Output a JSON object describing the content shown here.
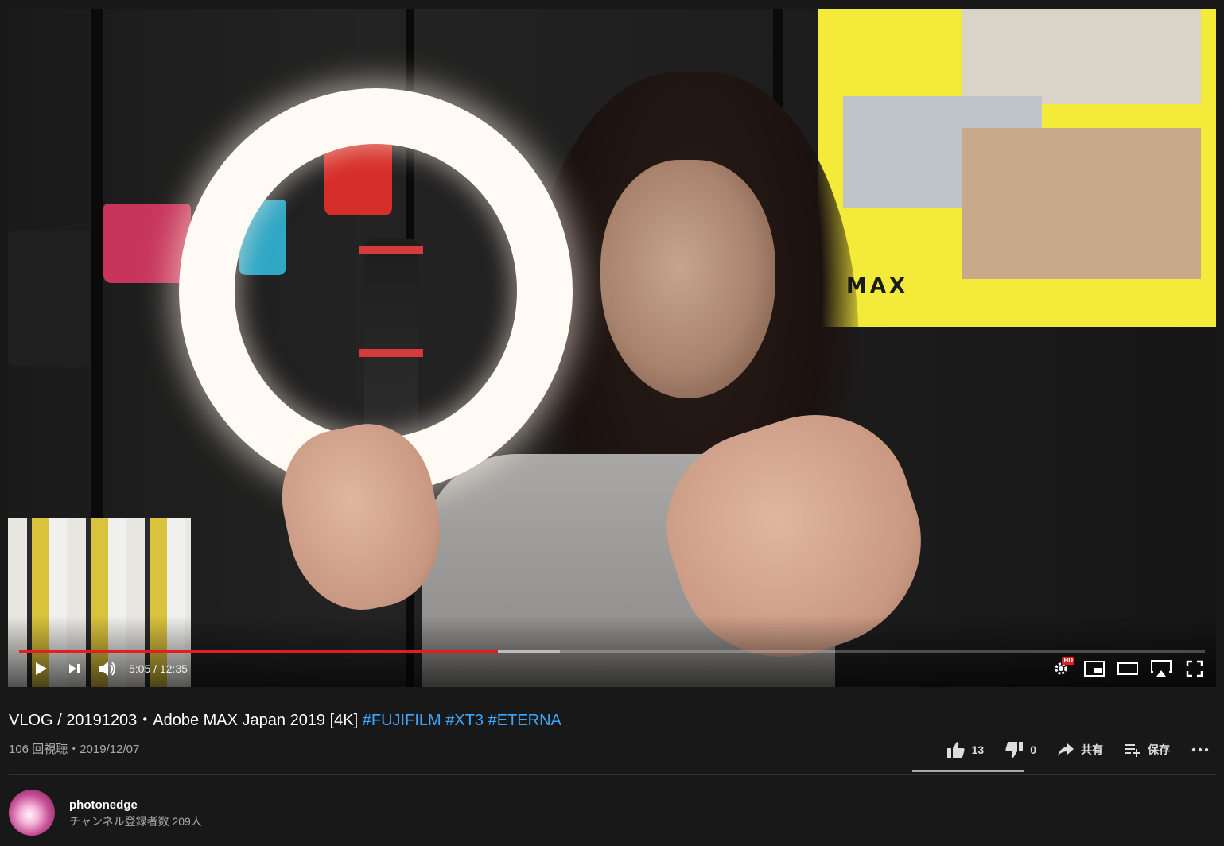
{
  "player": {
    "progress": {
      "current": "5:05",
      "duration": "12:35",
      "played_fraction": 0.404,
      "buffered_fraction": 0.456
    },
    "time_separator": " / ",
    "hd_badge": "HD",
    "accent_color": "#e02020"
  },
  "video": {
    "title": "VLOG / 20191203・Adobe MAX Japan 2019 [4K]",
    "hashtags": [
      "#FUJIFILM",
      "#XT3",
      "#ETERNA"
    ],
    "views": "106 回視聴",
    "separator": "・",
    "date": "2019/12/07",
    "link_color": "#3ea6ff"
  },
  "actions": {
    "like_count": "13",
    "dislike_count": "0",
    "share_label": "共有",
    "save_label": "保存"
  },
  "channel": {
    "name": "photonedge",
    "subscribers": "チャンネル登録者数 209人"
  }
}
